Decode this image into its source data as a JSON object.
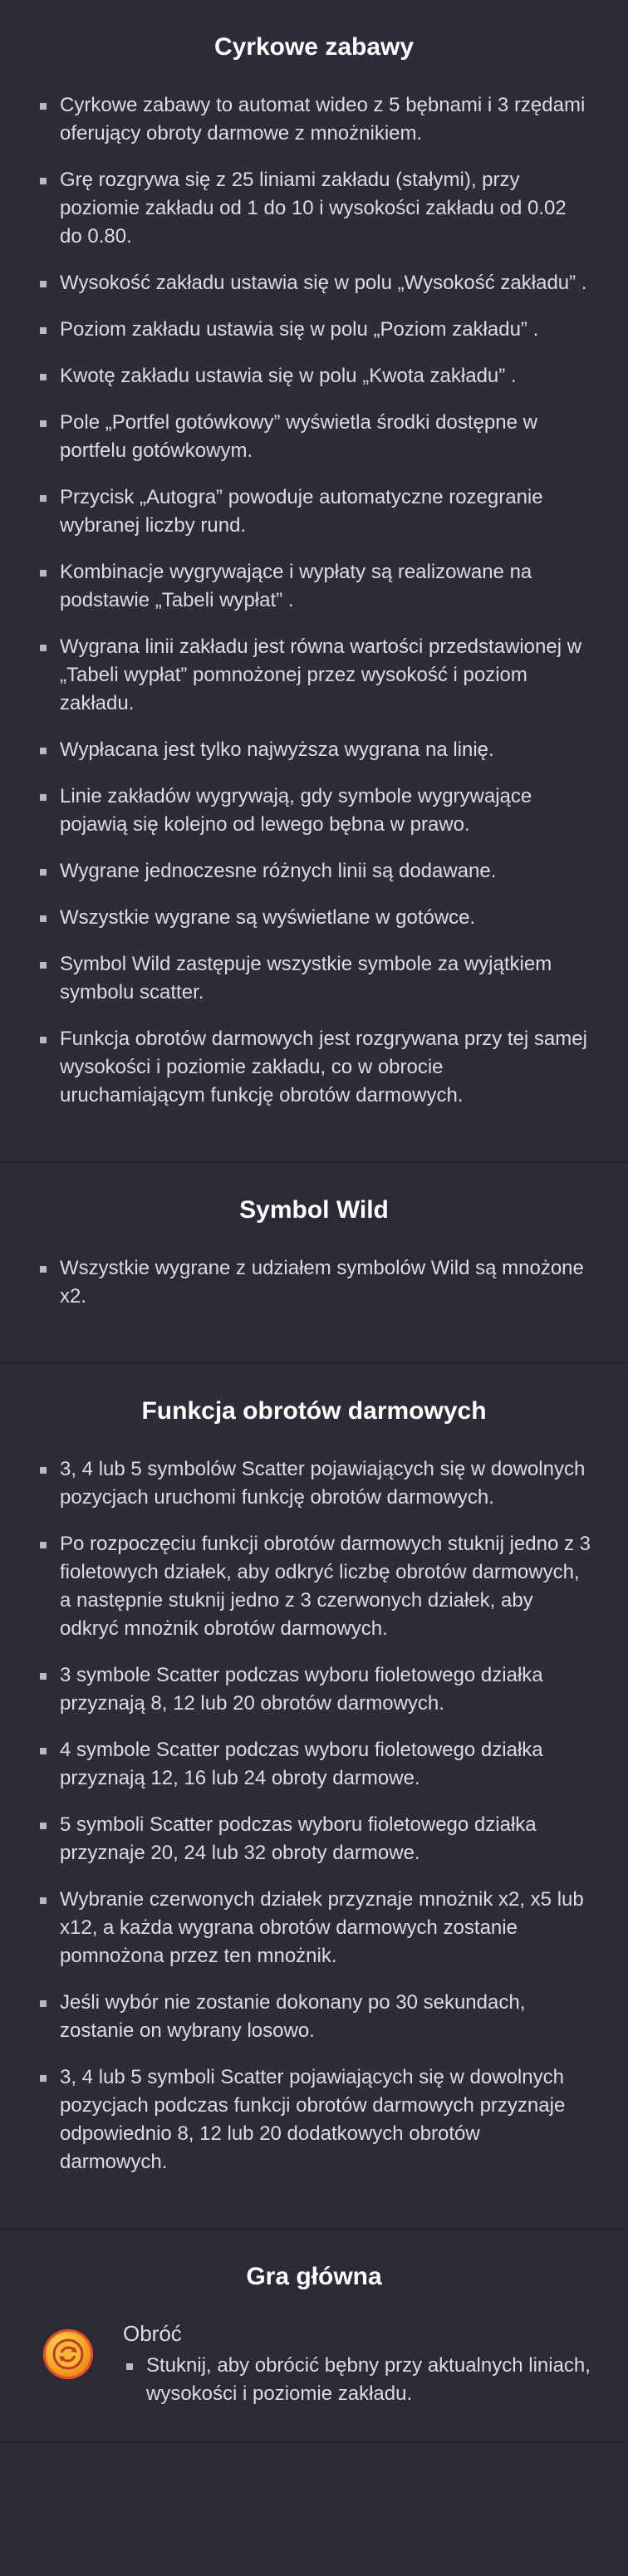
{
  "sections": [
    {
      "title": "Cyrkowe zabawy",
      "items": [
        "Cyrkowe zabawy to automat wideo z 5 bębnami i 3 rzędami oferujący obroty darmowe z mnożnikiem.",
        "Grę rozgrywa się z 25 liniami zakładu (stałymi), przy poziomie zakładu od 1 do 10 i wysokości zakładu od 0.02 do 0.80.",
        "Wysokość zakładu ustawia się w polu „Wysokość zakładu”  .",
        "Poziom zakładu ustawia się w polu „Poziom zakładu”  .",
        "Kwotę zakładu ustawia się w polu „Kwota zakładu”  .",
        "Pole „Portfel gotówkowy”   wyświetla środki dostępne w portfelu gotówkowym.",
        "Przycisk „Autogra”   powoduje automatyczne rozegranie wybranej liczby rund.",
        "Kombinacje wygrywające i wypłaty są realizowane na podstawie „Tabeli wypłat”  .",
        "Wygrana linii zakładu jest równa wartości przedstawionej w „Tabeli wypłat”   pomnożonej przez wysokość i poziom zakładu.",
        "Wypłacana jest tylko najwyższa wygrana na linię.",
        "Linie zakładów wygrywają, gdy symbole wygrywające pojawią się kolejno od lewego bębna w prawo.",
        "Wygrane jednoczesne różnych linii są dodawane.",
        "Wszystkie wygrane są wyświetlane w gotówce.",
        "Symbol Wild zastępuje wszystkie symbole za wyjątkiem symbolu scatter.",
        "Funkcja obrotów darmowych jest rozgrywana przy tej samej wysokości i poziomie zakładu, co w obrocie uruchamiającym funkcję obrotów darmowych."
      ]
    },
    {
      "title": "Symbol Wild",
      "items": [
        "Wszystkie wygrane z udziałem symbolów Wild są mnożone x2."
      ]
    },
    {
      "title": "Funkcja obrotów darmowych",
      "items": [
        "3, 4 lub 5 symbolów Scatter pojawiających się w dowolnych pozycjach uruchomi funkcję obrotów darmowych.",
        "Po rozpoczęciu funkcji obrotów darmowych stuknij jedno z 3 fioletowych działek, aby odkryć liczbę obrotów darmowych, a następnie stuknij jedno z 3 czerwonych działek, aby odkryć mnożnik obrotów darmowych.",
        "3 symbole Scatter podczas wyboru fioletowego działka przyznają 8, 12 lub 20 obrotów darmowych.",
        "4 symbole Scatter podczas wyboru fioletowego działka przyznają 12, 16 lub 24 obroty darmowe.",
        "5 symboli Scatter podczas wyboru fioletowego działka przyznaje 20, 24 lub 32 obroty darmowe.",
        "Wybranie czerwonych działek przyznaje mnożnik x2, x5 lub x12, a każda wygrana obrotów darmowych zostanie pomnożona przez ten mnożnik.",
        "Jeśli wybór nie zostanie dokonany po 30 sekundach, zostanie on wybrany losowo.",
        "3, 4 lub 5 symboli Scatter pojawiających się w dowolnych pozycjach podczas funkcji obrotów darmowych przyznaje odpowiednio 8, 12 lub 20 dodatkowych obrotów darmowych."
      ]
    }
  ],
  "main_game": {
    "title": "Gra główna",
    "spin_title": "Obróć",
    "spin_text": "Stuknij, aby obrócić bębny przy aktualnych liniach, wysokości i poziomie zakładu.",
    "spin_icon": "spin-icon"
  }
}
